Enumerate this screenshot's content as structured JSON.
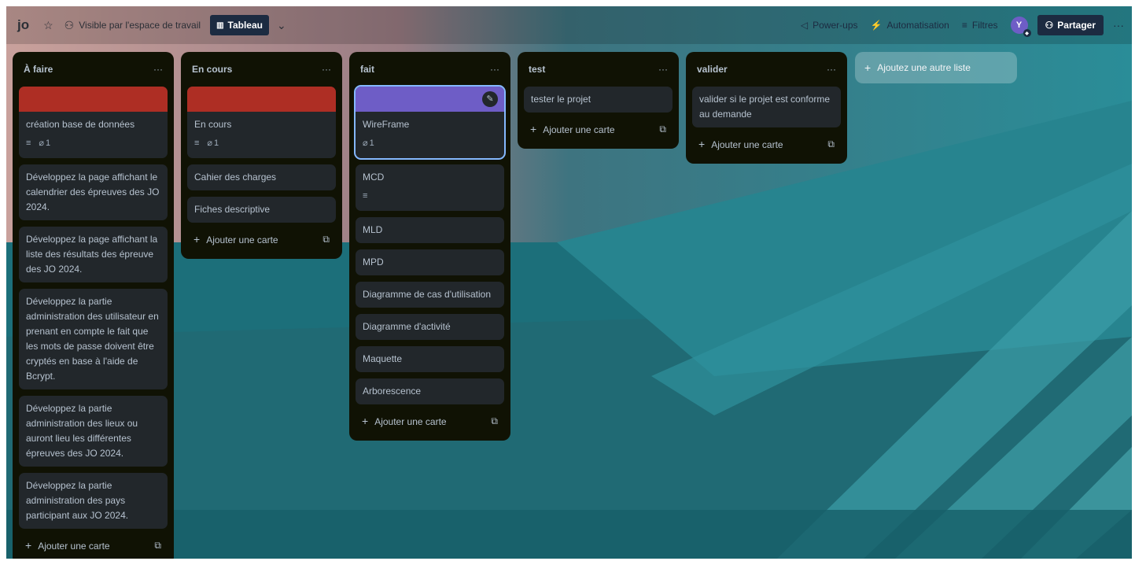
{
  "board": {
    "name": "jo",
    "visibility": "Visible par l'espace de travail",
    "view": "Tableau"
  },
  "topbar": {
    "powerups": "Power-ups",
    "automation": "Automatisation",
    "filters": "Filtres",
    "avatar": "Y",
    "share": "Partager"
  },
  "colors": {
    "cover_red": "#ae2e24",
    "cover_purple": "#6e5dc6",
    "list_bg": "#101204",
    "card_bg": "#22272b"
  },
  "lists": [
    {
      "title": "À faire",
      "cards": [
        {
          "title": "création base de données",
          "attachments": "1"
        },
        {
          "title": "Développez la page affichant le calendrier des épreuves des JO 2024."
        },
        {
          "title": "Développez la page affichant la liste des résultats des épreuve des JO 2024."
        },
        {
          "title": "Développez la partie administration des utilisateur en prenant en compte le fait que les mots de passe doivent être cryptés en base à l'aide de Bcrypt."
        },
        {
          "title": "Développez la partie administration des lieux ou auront lieu les différentes épreuves des JO 2024."
        },
        {
          "title": "Développez la partie administration des pays participant aux JO 2024."
        }
      ],
      "add_card": "Ajouter une carte"
    },
    {
      "title": "En cours",
      "cards": [
        {
          "title": "En cours",
          "attachments": "1"
        },
        {
          "title": "Cahier des charges"
        },
        {
          "title": "Fiches descriptive"
        }
      ],
      "add_card": "Ajouter une carte"
    },
    {
      "title": "fait",
      "cards": [
        {
          "title": "WireFrame",
          "attachments": "1"
        },
        {
          "title": "MCD"
        },
        {
          "title": "MLD"
        },
        {
          "title": "MPD"
        },
        {
          "title": "Diagramme de cas d'utilisation"
        },
        {
          "title": "Diagramme d'activité"
        },
        {
          "title": "Maquette"
        },
        {
          "title": "Arborescence"
        }
      ],
      "add_card": "Ajouter une carte"
    },
    {
      "title": "test",
      "cards": [
        {
          "title": "tester le projet"
        }
      ],
      "add_card": "Ajouter une carte"
    },
    {
      "title": "valider",
      "cards": [
        {
          "title": "valider si le projet est conforme au demande"
        }
      ],
      "add_card": "Ajouter une carte"
    }
  ],
  "add_list": "Ajoutez une autre liste"
}
